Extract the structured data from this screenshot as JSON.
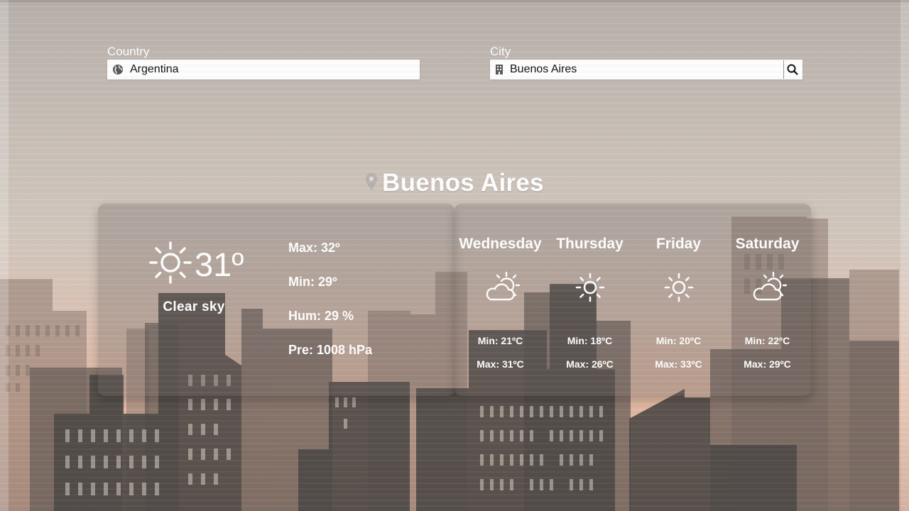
{
  "search": {
    "country": {
      "label": "Country",
      "value": "Argentina",
      "icon": "globe-icon"
    },
    "city": {
      "label": "City",
      "value": "Buenos Aires",
      "icon": "building-icon",
      "button_icon": "search-icon"
    }
  },
  "location": {
    "icon": "map-pin-icon",
    "name": "Buenos Aires"
  },
  "current": {
    "icon": "sun-icon",
    "temperature": "31º",
    "description": "Clear sky",
    "max": "Max: 32º",
    "min": "Min: 29º",
    "humidity": "Hum: 29 %",
    "pressure": "Pre: 1008 hPa"
  },
  "forecast": [
    {
      "day": "Wednesday",
      "icon": "partly-cloudy-icon",
      "min": "Min: 21ºC",
      "max": "Max: 31ºC"
    },
    {
      "day": "Thursday",
      "icon": "sun-icon",
      "min": "Min: 18ºC",
      "max": "Max: 26ºC"
    },
    {
      "day": "Friday",
      "icon": "sun-icon",
      "min": "Min: 20ºC",
      "max": "Max: 33ºC"
    },
    {
      "day": "Saturday",
      "icon": "partly-cloudy-icon",
      "min": "Min: 22ºC",
      "max": "Max: 29ºC"
    }
  ],
  "colors": {
    "text": "#ffffff",
    "panel": "#6e645f",
    "sky_top": "#b9b1ab",
    "sky_bottom": "#caa08c"
  }
}
